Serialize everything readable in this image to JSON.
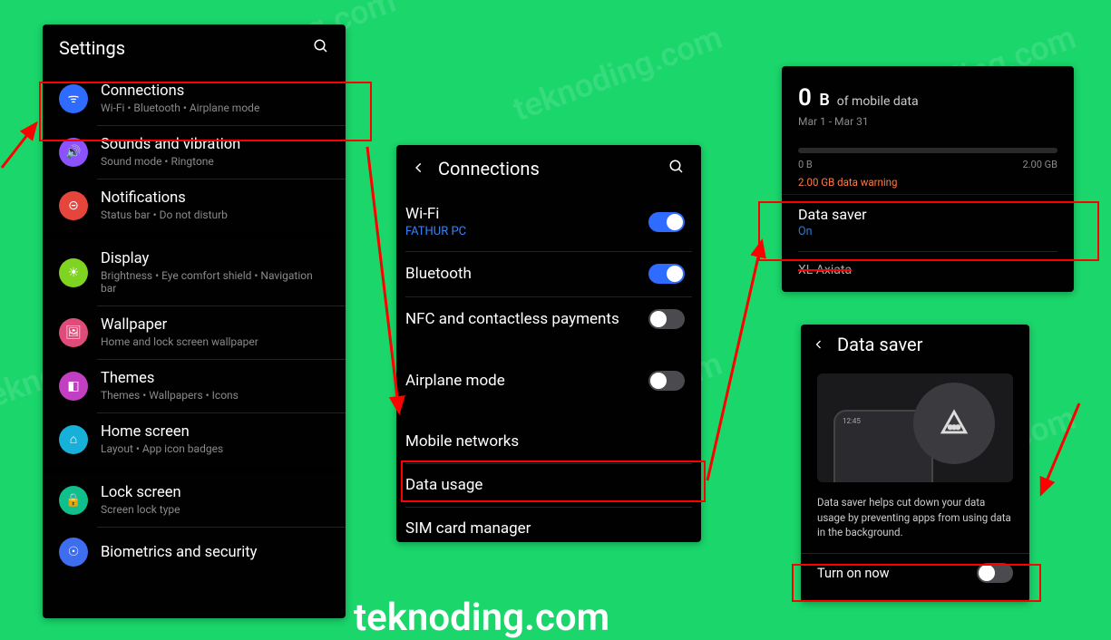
{
  "watermark": "teknoding.com",
  "panel1": {
    "title": "Settings",
    "items": [
      {
        "title": "Connections",
        "sub": "Wi-Fi  •  Bluetooth  •  Airplane mode",
        "iconClass": "ic-blue",
        "iconName": "wifi-icon",
        "glyph": "ᯤ"
      },
      {
        "title": "Sounds and vibration",
        "sub": "Sound mode  •  Ringtone",
        "iconClass": "ic-purple",
        "iconName": "sound-icon",
        "glyph": "🔊"
      },
      {
        "title": "Notifications",
        "sub": "Status bar  •  Do not disturb",
        "iconClass": "ic-red",
        "iconName": "notification-icon",
        "glyph": "⊝"
      },
      {
        "title": "Display",
        "sub": "Brightness  •  Eye comfort shield  •  Navigation bar",
        "iconClass": "ic-green",
        "iconName": "display-icon",
        "glyph": "☀"
      },
      {
        "title": "Wallpaper",
        "sub": "Home and lock screen wallpaper",
        "iconClass": "ic-pink",
        "iconName": "wallpaper-icon",
        "glyph": "🖼"
      },
      {
        "title": "Themes",
        "sub": "Themes  •  Wallpapers  •  Icons",
        "iconClass": "ic-magenta",
        "iconName": "themes-icon",
        "glyph": "◧"
      },
      {
        "title": "Home screen",
        "sub": "Layout  •  App icon badges",
        "iconClass": "ic-cyan",
        "iconName": "home-icon",
        "glyph": "⌂"
      },
      {
        "title": "Lock screen",
        "sub": "Screen lock type",
        "iconClass": "ic-teal",
        "iconName": "lock-icon",
        "glyph": "🔒"
      },
      {
        "title": "Biometrics and security",
        "sub": "",
        "iconClass": "ic-blue2",
        "iconName": "biometrics-icon",
        "glyph": "☉"
      }
    ]
  },
  "panel2": {
    "title": "Connections",
    "rows": [
      {
        "title": "Wi-Fi",
        "sub": "FATHUR PC",
        "toggle": true,
        "on": true
      },
      {
        "title": "Bluetooth",
        "sub": "",
        "toggle": true,
        "on": true
      },
      {
        "title": "NFC and contactless payments",
        "sub": "",
        "toggle": true,
        "on": false
      },
      {
        "title": "Airplane mode",
        "sub": "",
        "toggle": true,
        "on": false
      },
      {
        "title": "Mobile networks",
        "sub": "",
        "toggle": false
      },
      {
        "title": "Data usage",
        "sub": "",
        "toggle": false
      },
      {
        "title": "SIM card manager",
        "sub": "",
        "toggle": false
      }
    ]
  },
  "panel3": {
    "usage_value": "0",
    "usage_unit": "B",
    "usage_suffix": "of mobile data",
    "range": "Mar 1 - Mar 31",
    "bar_min": "0 B",
    "bar_max": "2.00 GB",
    "warning_text": "2.00 GB data warning",
    "data_saver_title": "Data saver",
    "data_saver_status": "On",
    "carrier": "XL Axiata"
  },
  "panel4": {
    "title": "Data saver",
    "description": "Data saver helps cut down your data usage by preventing apps from using data in the background.",
    "toggle_label": "Turn on now",
    "toggle_on": false,
    "time": "12:45"
  }
}
